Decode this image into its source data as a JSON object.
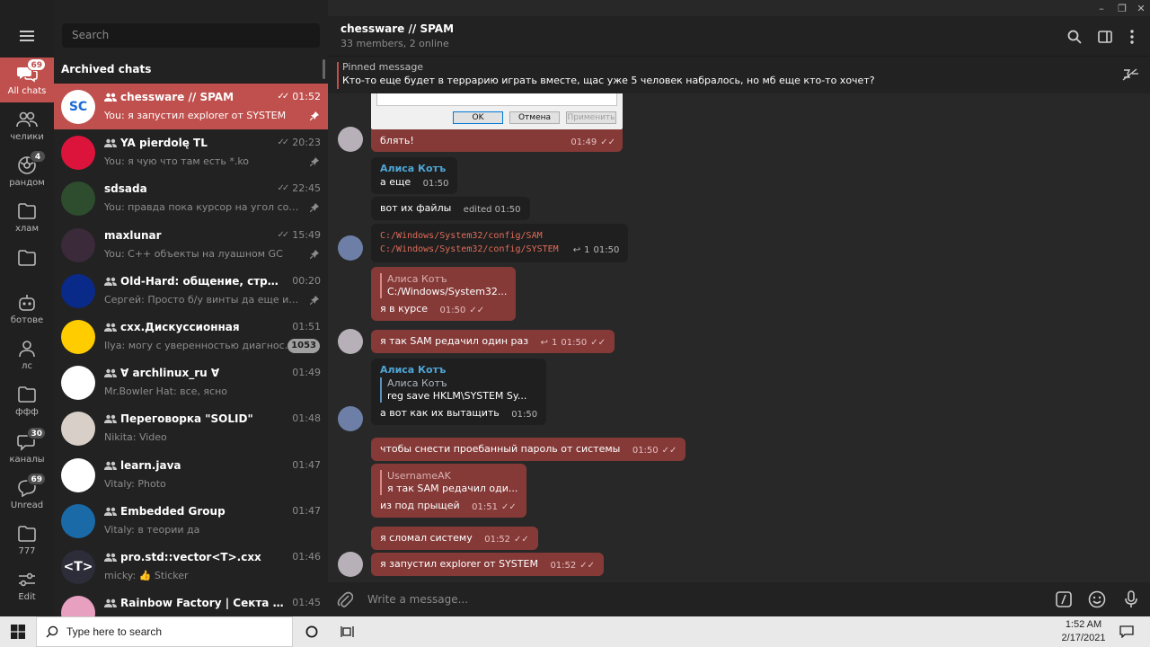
{
  "window": {
    "minimize": "–",
    "maximize": "❐",
    "close": "✕"
  },
  "sidebar": {
    "folders": [
      {
        "label": "All chats",
        "badge": "69",
        "icon": "chat-bubbles-icon"
      },
      {
        "label": "челики",
        "badge": "",
        "icon": "people-icon"
      },
      {
        "label": "рандом",
        "badge": "4",
        "icon": "random-icon"
      },
      {
        "label": "хлам",
        "badge": "",
        "icon": "folder-icon"
      },
      {
        "label": "",
        "badge": "",
        "icon": "folder-icon"
      },
      {
        "label": "ботове",
        "badge": "",
        "icon": "bot-icon"
      },
      {
        "label": "лс",
        "badge": "",
        "icon": "person-icon"
      },
      {
        "label": "ффф",
        "badge": "",
        "icon": "folder-icon"
      },
      {
        "label": "каналы",
        "badge": "30",
        "icon": "channel-icon"
      },
      {
        "label": "Unread",
        "badge": "69",
        "icon": "unread-icon"
      },
      {
        "label": "777",
        "badge": "",
        "icon": "folder-icon"
      },
      {
        "label": "Edit",
        "badge": "",
        "icon": "sliders-icon"
      }
    ]
  },
  "chatlist": {
    "search_placeholder": "Search",
    "archived_label": "Archived chats",
    "chats": [
      {
        "title": "chessware // SPAM",
        "group": true,
        "time": "01:52",
        "ticks": true,
        "preview": "You: я запустил explorer от SYSTEM",
        "pinned": true,
        "badge": "",
        "avatar_text": "SC",
        "avatar_color": "#ffffff"
      },
      {
        "title": "YA pierdolę TL",
        "group": true,
        "time": "20:23",
        "ticks": true,
        "preview": "You: я чую что там есть *.ko",
        "pinned": true,
        "badge": "",
        "avatar_text": "",
        "avatar_color": "#dc143c"
      },
      {
        "title": "sdsada",
        "group": false,
        "time": "22:45",
        "ticks": true,
        "preview": "You: правда пока курсор на угол соскаки...",
        "pinned": true,
        "badge": "",
        "avatar_text": "",
        "avatar_color": "#2e4d2e"
      },
      {
        "title": "maxlunar",
        "group": false,
        "time": "15:49",
        "ticks": true,
        "preview": "You: C++ объекты на луашном GC",
        "pinned": true,
        "badge": "",
        "avatar_text": "",
        "avatar_color": "#3a2a3a"
      },
      {
        "title": "Old-Hard: общение, страдания, ра...",
        "group": true,
        "time": "00:20",
        "ticks": false,
        "preview": "Сергей: Просто б/у винты да еще и посл...",
        "pinned": true,
        "badge": "",
        "avatar_text": "",
        "avatar_color": "#0a2a8a"
      },
      {
        "title": "cxx.Дискуссионная",
        "group": true,
        "time": "01:51",
        "ticks": false,
        "preview": "Ilya: могу с уверенностью диагностир...",
        "pinned": false,
        "badge": "1053",
        "avatar_text": "",
        "avatar_color": "#ffcc00"
      },
      {
        "title": "Ɐ archlinux_ru Ɐ",
        "group": true,
        "time": "01:49",
        "ticks": false,
        "preview": "Mr.Bowler Hat: все, ясно",
        "pinned": false,
        "badge": "",
        "avatar_text": "",
        "avatar_color": "#ffffff"
      },
      {
        "title": "Переговорка \"SOLID\"",
        "group": true,
        "time": "01:48",
        "ticks": false,
        "preview": "Nikita: Video",
        "pinned": false,
        "badge": "",
        "avatar_text": "",
        "avatar_color": "#d8d0c8"
      },
      {
        "title": "learn.java",
        "group": true,
        "time": "01:47",
        "ticks": false,
        "preview": "Vitaly: Photo",
        "pinned": false,
        "badge": "",
        "avatar_text": "",
        "avatar_color": "#ffffff"
      },
      {
        "title": "Embedded Group",
        "group": true,
        "time": "01:47",
        "ticks": false,
        "preview": "Vitaly: в теории да",
        "pinned": false,
        "badge": "",
        "avatar_text": "",
        "avatar_color": "#1a6aa8"
      },
      {
        "title": "pro.std::vector<T>.cxx",
        "group": true,
        "time": "01:46",
        "ticks": false,
        "preview": "micky: 👍 Sticker",
        "pinned": false,
        "badge": "",
        "avatar_text": "<T>",
        "avatar_color": "#2d2d3a"
      },
      {
        "title": "Rainbow Factory | Секта перделик...",
        "group": true,
        "time": "01:45",
        "ticks": false,
        "preview": "",
        "pinned": false,
        "badge": "",
        "avatar_text": "",
        "avatar_color": "#e8a0c0"
      }
    ]
  },
  "chat": {
    "title": "chessware // SPAM",
    "subtitle": "33 members, 2 online",
    "pinned_title": "Pinned message",
    "pinned_text": "Кто-то еще будет в террарию играть вместе, щас уже 5 человек набралось, но мб еще кто-то хочет?",
    "dialog_buttons": {
      "ok": "OK",
      "cancel": "Отмена",
      "apply": "Применить"
    },
    "messages": {
      "m1": {
        "text": "блять!",
        "time": "01:49"
      },
      "m2": {
        "name": "Алиса Котъ",
        "text": "а еще",
        "time": "01:50"
      },
      "m3": {
        "text": "вот их файлы",
        "time": "edited 01:50"
      },
      "m4": {
        "line1": "C:/Windows/System32/config/SAM",
        "line2": "C:/Windows/System32/config/SYSTEM",
        "replies": "1",
        "time": "01:50"
      },
      "m5": {
        "reply_name": "Алиса Котъ",
        "reply_text": "C:/Windows/System32...",
        "text": "я в курсе",
        "time": "01:50"
      },
      "m6": {
        "text": "я так SAM редачил один раз",
        "replies": "1",
        "time": "01:50"
      },
      "m7": {
        "name": "Алиса Котъ",
        "reply_name": "Алиса Котъ",
        "reply_text": "reg save HKLM\\SYSTEM Sy...",
        "text": "а вот как их вытащить",
        "time": "01:50"
      },
      "m8": {
        "text": "чтобы снести проебанный пароль от системы",
        "time": "01:50"
      },
      "m9": {
        "reply_name": "UsernameAK",
        "reply_text": "я так SAM редачил оди...",
        "text": "из под прыщей",
        "time": "01:51"
      },
      "m10": {
        "text": "я сломал систему",
        "time": "01:52"
      },
      "m11": {
        "text": "я запустил explorer от SYSTEM",
        "time": "01:52"
      }
    },
    "composer_placeholder": "Write a message..."
  },
  "taskbar": {
    "search_placeholder": "Type here to search",
    "time": "1:52 AM",
    "date": "2/17/2021"
  },
  "colors": {
    "accent": "#c0504d",
    "outgoing_bubble": "#853a38",
    "incoming_bubble": "#1f1f1f",
    "link_name": "#4fa6d6"
  }
}
